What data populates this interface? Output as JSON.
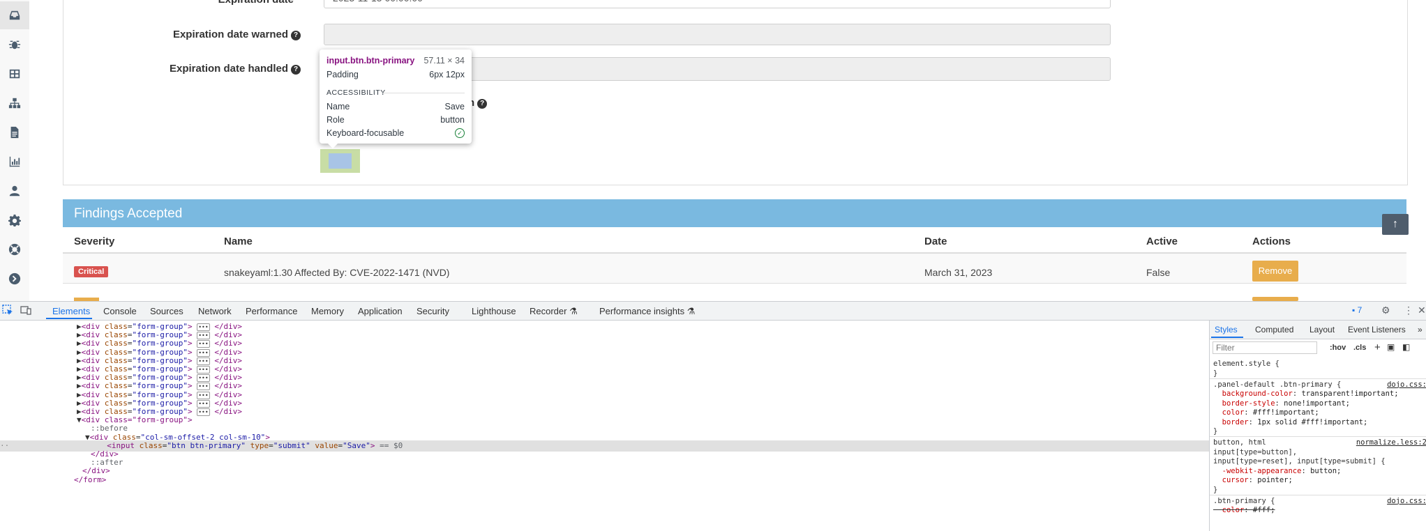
{
  "sidebar": {
    "items": [
      {
        "icon": "inbox-icon",
        "active": true
      },
      {
        "icon": "bug-icon"
      },
      {
        "icon": "grid-icon"
      },
      {
        "icon": "sitemap-icon"
      },
      {
        "icon": "file-icon"
      },
      {
        "icon": "bar-chart-icon"
      },
      {
        "icon": "user-icon"
      },
      {
        "icon": "gear-icon"
      },
      {
        "icon": "lifebuoy-icon"
      },
      {
        "icon": "arrow-circle-right-icon"
      }
    ]
  },
  "form": {
    "expiration_date_label": "Expiration date",
    "expiration_date_value": "2023-11-15 00:00:00",
    "expiration_date_warned_label": "Expiration date warned",
    "expiration_date_handled_label": "Expiration date handled",
    "hidden_label_tail": "n",
    "help_glyph": "?"
  },
  "tooltip": {
    "selector": "input.btn.btn-primary",
    "size": "57.11 × 34",
    "padding_label": "Padding",
    "padding_value": "6px 12px",
    "section": "ACCESSIBILITY",
    "name_label": "Name",
    "name_value": "Save",
    "role_label": "Role",
    "role_value": "button",
    "focusable_label": "Keyboard-focusable",
    "check_glyph": "✓"
  },
  "findings": {
    "title": "Findings Accepted",
    "scroll_top_glyph": "↑",
    "columns": {
      "severity": "Severity",
      "name": "Name",
      "date": "Date",
      "active": "Active",
      "actions": "Actions"
    },
    "rows": [
      {
        "severity": "Critical",
        "name": "snakeyaml:1.30 Affected By: CVE-2022-1471 (NVD)",
        "date": "March 31, 2023",
        "active": "False",
        "action": "Remove"
      }
    ]
  },
  "devtools": {
    "tabs": [
      "Elements",
      "Console",
      "Sources",
      "Network",
      "Performance",
      "Memory",
      "Application",
      "Security",
      "Lighthouse",
      "Recorder",
      "Performance insights"
    ],
    "issues_count": "7",
    "elements": {
      "collapsed_group": {
        "open": "<div",
        "attr": "class",
        "val": "\"form-group\"",
        "close": "</div>"
      },
      "open_group": "<div class=\"form-group\">",
      "before": "::before",
      "col_div": {
        "tag": "<div",
        "attr": "class",
        "val": "\"col-sm-offset-2 col-sm-10\""
      },
      "selected_input": {
        "tag": "<input",
        "class_val": "\"btn btn-primary\"",
        "type_val": "\"submit\"",
        "value_val": "\"Save\"",
        "suffix": "== $0"
      },
      "div_close": "</div>",
      "after": "::after",
      "form_close": "</form>"
    },
    "styles": {
      "tabs": [
        "Styles",
        "Computed",
        "Layout",
        "Event Listeners"
      ],
      "filter_placeholder": "Filter",
      "hov": ":hov",
      "cls": ".cls",
      "rules": [
        {
          "selector": "element.style {",
          "close": "}"
        },
        {
          "selector": ".panel-default .btn-primary {",
          "source": "dojo.css:",
          "decls": [
            [
              "background-color",
              "transparent!important;"
            ],
            [
              "border-style",
              "none!important;"
            ],
            [
              "color",
              "#fff!important;"
            ],
            [
              "border",
              "1px solid #fff!important;"
            ]
          ]
        },
        {
          "selector": "button, html input[type=button], input[type=reset], input[type=submit] {",
          "source": "normalize.less:2",
          "decls": [
            [
              "-webkit-appearance",
              "button;"
            ],
            [
              "cursor",
              "pointer;"
            ]
          ]
        },
        {
          "selector": ".btn-primary {",
          "source": "dojo.css:",
          "decls": [
            [
              "color",
              "#fff;"
            ]
          ]
        }
      ]
    }
  }
}
